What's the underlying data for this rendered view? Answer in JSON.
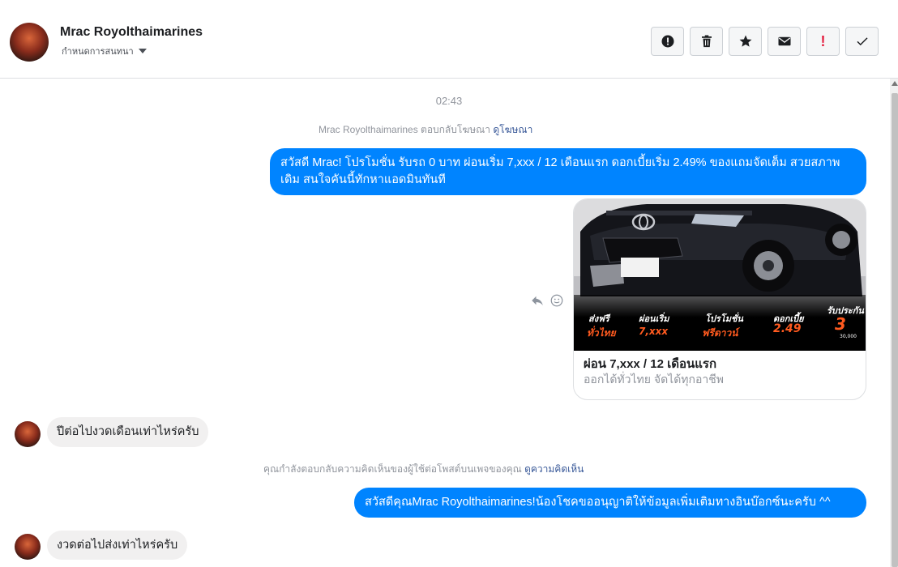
{
  "header": {
    "name": "Mrac Royolthaimarines",
    "assign_label": "กำหนดการสนทนา",
    "toolbar": {
      "spam_icon": "alert-circle-icon",
      "delete_icon": "trash-icon",
      "star_icon": "star-icon",
      "unread_icon": "envelope-icon",
      "important_label": "!",
      "done_icon": "checkmark-icon"
    }
  },
  "conversation": {
    "timestamp": "02:43",
    "ad_reply_notice": "Mrac Royolthaimarines ตอบกลับโฆษณา",
    "ad_link": "ดูโฆษณา",
    "msg_promo": "สวัสดี Mrac! โปรโมชั่น รับรถ 0 บาท ผ่อนเริ่ม 7,xxx / 12 เดือนแรก ดอกเบี้ยเริ่ม 2.49% ของแถมจัดเต็ม สวยสภาพเดิม สนใจคันนี้ทักหาแอดมินทันที",
    "card": {
      "title": "ผ่อน 7,xxx / 12 เดือนแรก",
      "subtitle": "ออกได้ทั่วไทย จัดได้ทุกอาชีพ",
      "promo": {
        "l1": "ส่งฟรี",
        "v1": "ทั่วไทย",
        "l2": "ผ่อนเริ่ม",
        "v2": "7,xxx",
        "l3": "โปรโมชั่น",
        "v3": "ฟรีดาวน์",
        "l4": "ดอกเบี้ย",
        "v4": "2.49",
        "l5": "รับประกัน",
        "v5": "3",
        "v5b": "30,000"
      }
    },
    "msg_customer_1": "ปีต่อไปงวดเดือนเท่าไหร่ครับ",
    "comment_notice": "คุณกำลังตอบกลับความคิดเห็นของผู้ใช้ต่อโพสต์บนเพจของคุณ",
    "comment_link": "ดูความคิดเห็น",
    "msg_reply": "สวัสดีคุณMrac Royolthaimarines!น้องโชคขออนุญาติให้ข้อมูลเพิ่มเติมทางอินบ๊อกซ์นะครับ ^^",
    "msg_customer_2": "งวดต่อไปส่งเท่าไหร่ครับ"
  },
  "colors": {
    "outgoing": "#0084ff",
    "incoming": "#f1f0f0",
    "link": "#385898",
    "meta": "#90949c"
  }
}
